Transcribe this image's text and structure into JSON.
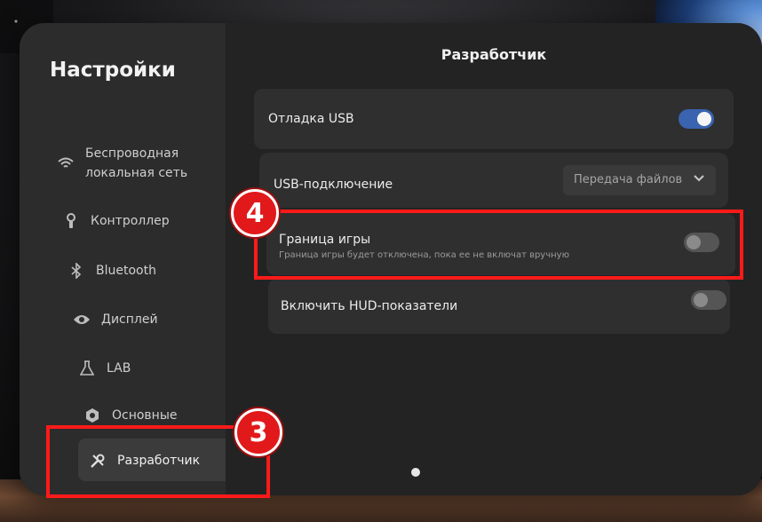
{
  "sidebar": {
    "title": "Настройки",
    "items": [
      {
        "label": "Беспроводная\nлокальная сеть",
        "icon": "wifi-icon"
      },
      {
        "label": "Контроллер",
        "icon": "controller-icon"
      },
      {
        "label": "Bluetooth",
        "icon": "bluetooth-icon"
      },
      {
        "label": "Дисплей",
        "icon": "eye-icon"
      },
      {
        "label": "LAB",
        "icon": "flask-icon"
      },
      {
        "label": "Основные",
        "icon": "gear-icon"
      },
      {
        "label": "Разработчик",
        "icon": "tools-icon",
        "active": true
      }
    ]
  },
  "main": {
    "title": "Разработчик",
    "usb_debug": {
      "label": "Отладка USB",
      "on": true
    },
    "usb_connection": {
      "label": "USB-подключение",
      "value": "Передача файлов"
    },
    "boundary": {
      "label": "Граница игры",
      "description": "Граница игры будет отключена, пока ее не включат вручную",
      "on": false
    },
    "hud": {
      "label": "Включить HUD-показатели",
      "on": false
    }
  },
  "annotations": {
    "step3": "3",
    "step4": "4",
    "highlight_color": "#ff1a1a"
  },
  "colors": {
    "toggle_on": "#3a63b0",
    "panel_bg": "#262626"
  }
}
